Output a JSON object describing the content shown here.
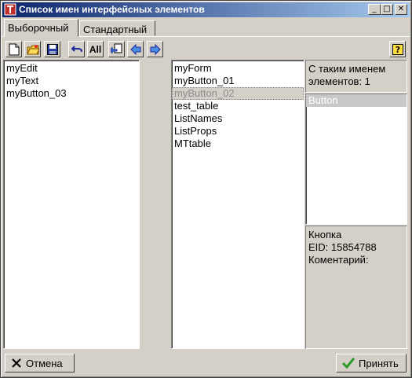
{
  "window": {
    "title": "Список имен интерфейсных элементов",
    "controls": {
      "minimize": "_",
      "maximize": "□",
      "close": "✕"
    }
  },
  "tabs": [
    {
      "label": "Выборочный",
      "active": true
    },
    {
      "label": "Стандартный",
      "active": false
    }
  ],
  "toolbar": {
    "buttons": [
      "new-doc-icon",
      "open-folder-icon",
      "save-disk-icon",
      "undo-icon",
      "all",
      "copy-back-icon",
      "left-arrow-icon",
      "right-arrow-icon"
    ],
    "all_label": "All",
    "help_icon": "help-icon"
  },
  "left_list": {
    "items": [
      "myEdit",
      "myText",
      "myButton_03"
    ]
  },
  "middle_list": {
    "items": [
      "myForm",
      "myButton_01",
      "myButton_02",
      "test_table",
      "ListNames",
      "ListProps",
      "MTtable"
    ],
    "selected_index": 2
  },
  "info": {
    "count_label": "С таким именем элементов: 1",
    "type_list": [
      "Button"
    ],
    "details": [
      "Кнопка",
      "EID: 15854788",
      "Коментарий:"
    ]
  },
  "buttons": {
    "cancel": "Отмена",
    "accept": "Принять"
  },
  "colors": {
    "titlebar_start": "#0a246a",
    "titlebar_end": "#a6caf0",
    "face": "#d4d0c8"
  }
}
